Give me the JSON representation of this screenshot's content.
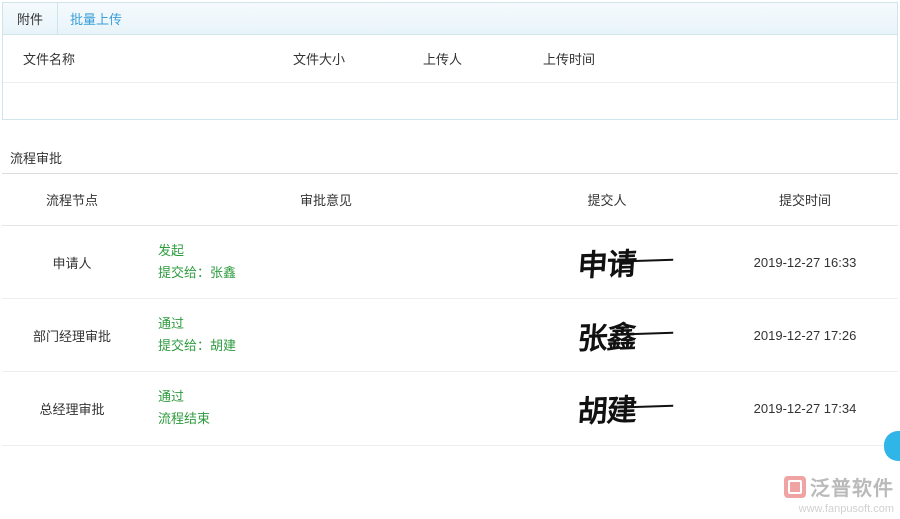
{
  "attachments": {
    "tab_label": "附件",
    "bulk_upload": "批量上传",
    "headers": {
      "filename": "文件名称",
      "filesize": "文件大小",
      "uploader": "上传人",
      "upload_time": "上传时间"
    }
  },
  "approval": {
    "section_title": "流程审批",
    "headers": {
      "node": "流程节点",
      "opinion": "审批意见",
      "submitter": "提交人",
      "submit_time": "提交时间"
    },
    "submit_to_prefix": "提交给：",
    "rows": [
      {
        "node": "申请人",
        "status": "发起",
        "submit_to": "张鑫",
        "submit_time": "2019-12-27 16:33",
        "signature_glyph": "申请"
      },
      {
        "node": "部门经理审批",
        "status": "通过",
        "submit_to": "胡建",
        "submit_time": "2019-12-27 17:26",
        "signature_glyph": "张鑫"
      },
      {
        "node": "总经理审批",
        "status": "通过",
        "end_text": "流程结束",
        "submit_time": "2019-12-27 17:34",
        "signature_glyph": "胡建"
      }
    ]
  },
  "watermark": {
    "brand": "泛普软件",
    "url": "www.fanpusoft.com"
  }
}
